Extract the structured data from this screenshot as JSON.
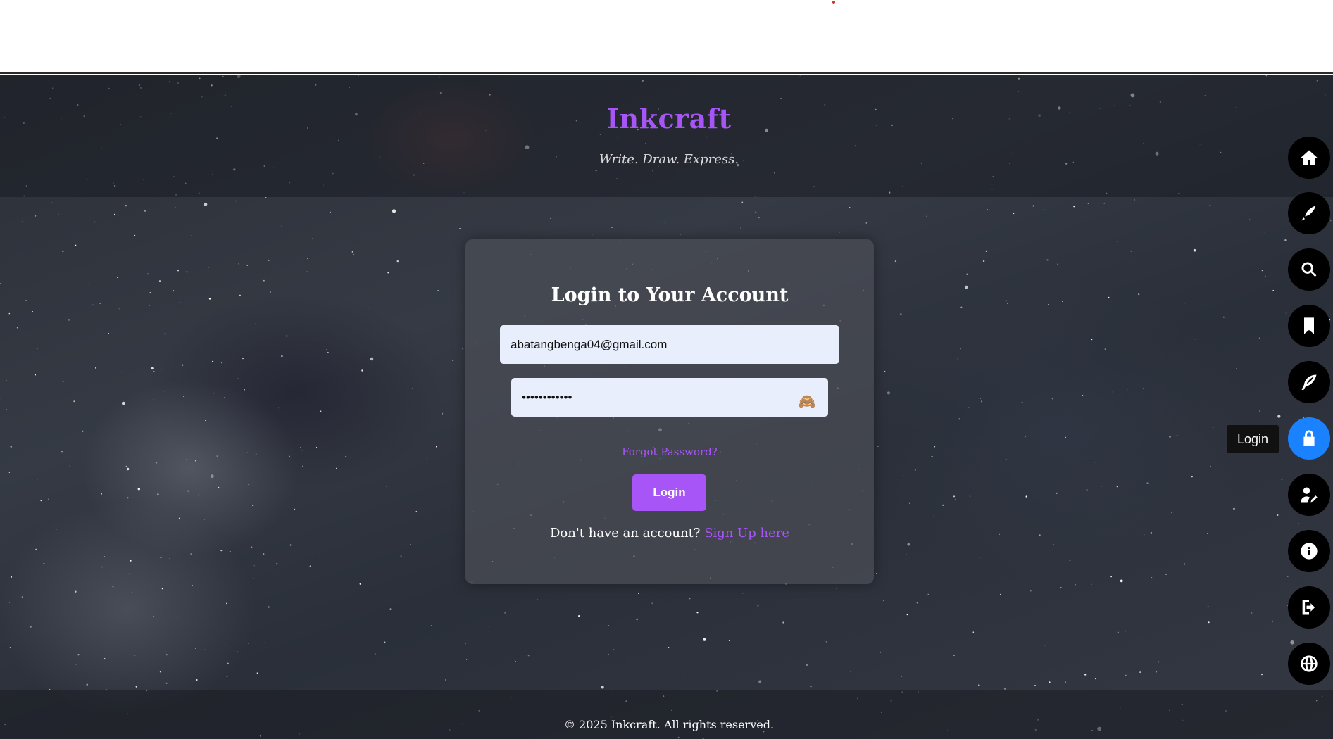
{
  "site": {
    "title": "Inkcraft",
    "tagline": "Write. Draw. Express."
  },
  "login_form": {
    "heading": "Login to Your Account",
    "email_value": "abatangbenga04@gmail.com",
    "password_value": "••••••••••••",
    "password_toggle_icon": "🙈",
    "forgot_password": "Forgot Password?",
    "submit_label": "Login",
    "signup_prompt": "Don't have an account?",
    "signup_link": "Sign Up here"
  },
  "footer": {
    "copyright": "© 2025 Inkcraft. All rights reserved."
  },
  "side_nav": {
    "items": [
      {
        "icon": "home-icon"
      },
      {
        "icon": "pen-icon"
      },
      {
        "icon": "search-icon"
      },
      {
        "icon": "bookmark-icon"
      },
      {
        "icon": "feather-icon"
      },
      {
        "icon": "lock-icon",
        "active": true
      },
      {
        "icon": "user-edit-icon"
      },
      {
        "icon": "info-icon"
      },
      {
        "icon": "logout-icon"
      },
      {
        "icon": "globe-icon"
      }
    ],
    "tooltip": "Login"
  },
  "colors": {
    "accent": "#a855f7",
    "active_nav": "#1a82ff",
    "input_bg": "#e8eefc"
  }
}
